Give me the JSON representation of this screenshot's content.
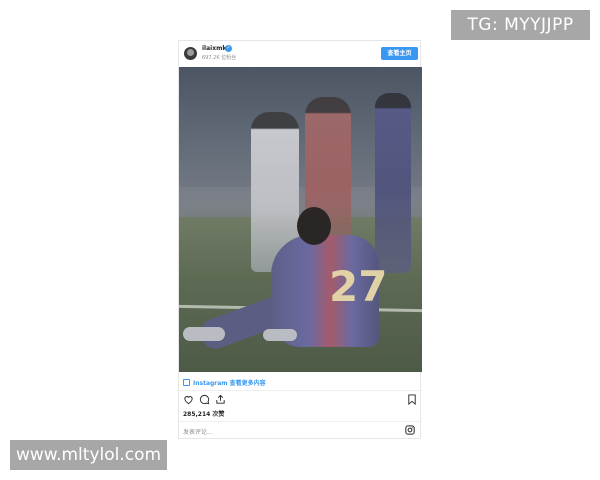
{
  "watermark_tg": "TG: MYYJJPP",
  "watermark_site": "www.mltylol.com",
  "post": {
    "username": "ilaixmk",
    "followers": "697.2K 位粉丝",
    "view_profile": "查看主页",
    "instagram_link": "Instagram 查看更多内容",
    "jersey_number": "27",
    "likes": "285,214 次赞",
    "comment_placeholder": "发表评论..."
  },
  "colors": {
    "accent": "#3897f0",
    "watermark_bg": "#a7a7a7"
  },
  "icons": [
    "verified-icon",
    "heart-icon",
    "comment-icon",
    "share-icon",
    "bookmark-icon",
    "instagram-icon"
  ]
}
